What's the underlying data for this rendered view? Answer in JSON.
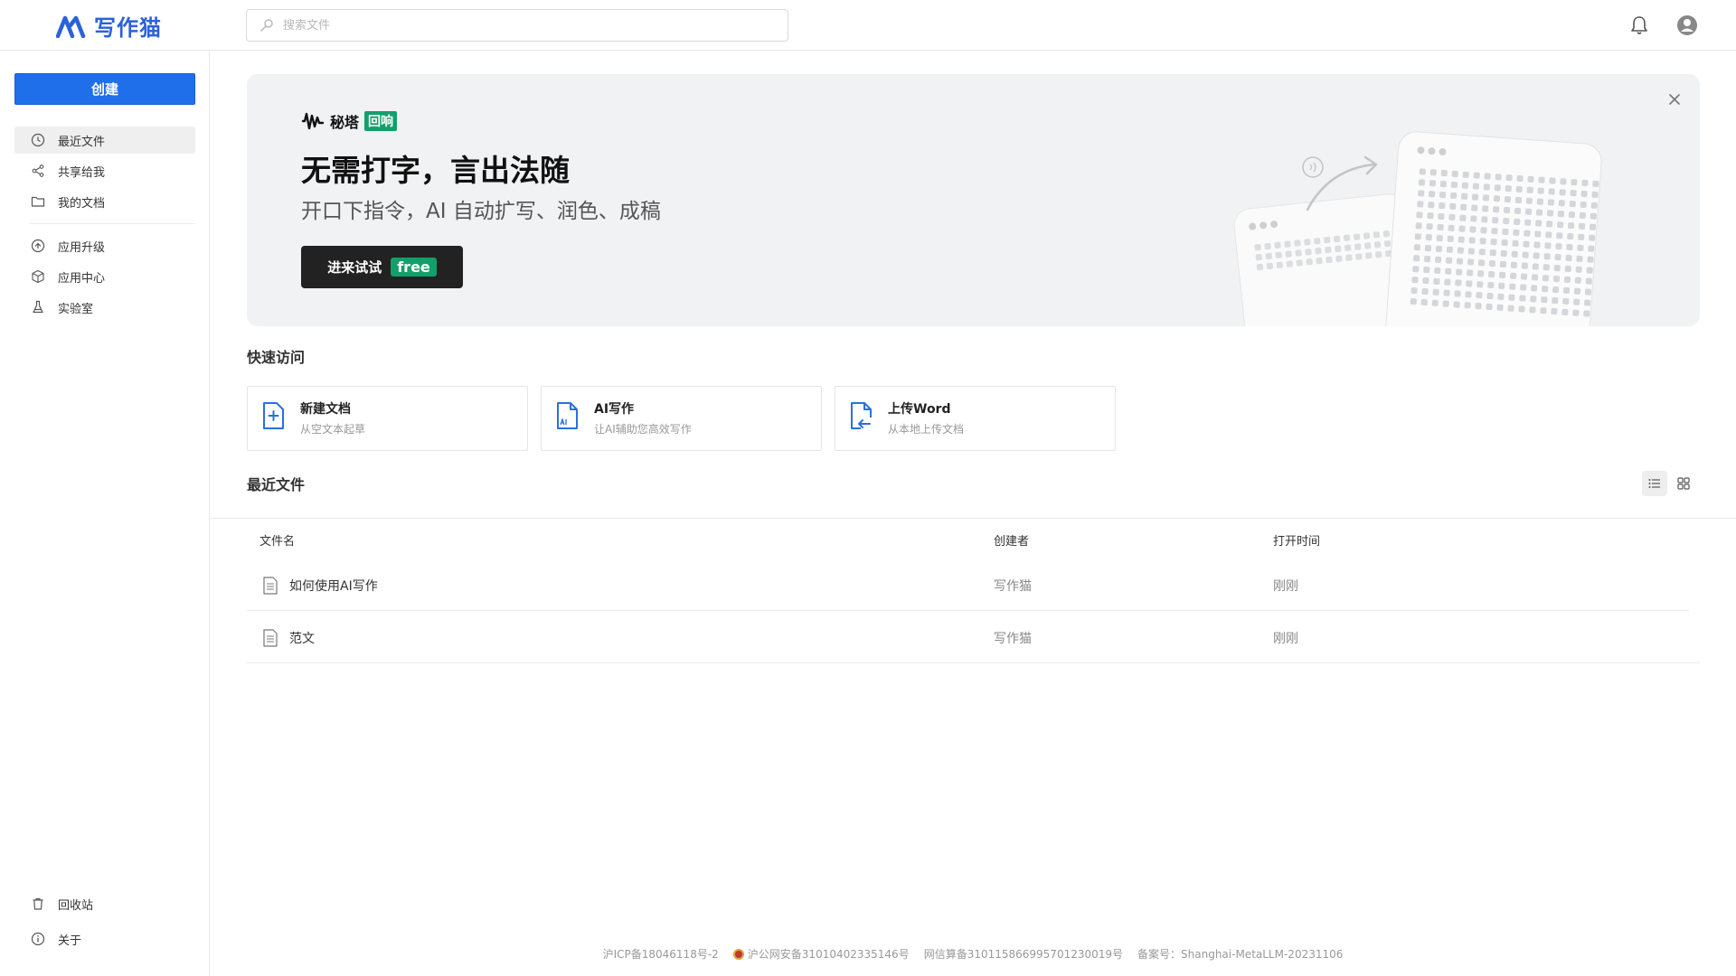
{
  "header": {
    "logo_text": "写作猫",
    "search_placeholder": "搜索文件"
  },
  "sidebar": {
    "create_label": "创建",
    "nav_main": [
      {
        "label": "最近文件",
        "icon": "clock-icon"
      },
      {
        "label": "共享给我",
        "icon": "share-icon"
      },
      {
        "label": "我的文档",
        "icon": "folder-icon"
      }
    ],
    "nav_apps": [
      {
        "label": "应用升级",
        "icon": "upgrade-icon"
      },
      {
        "label": "应用中心",
        "icon": "box-icon"
      },
      {
        "label": "实验室",
        "icon": "flask-icon"
      }
    ],
    "nav_bottom": [
      {
        "label": "回收站",
        "icon": "trash-icon"
      },
      {
        "label": "关于",
        "icon": "info-icon"
      }
    ]
  },
  "banner": {
    "brand_name": "秘塔",
    "brand_tag": "回响",
    "title": "无需打字，言出法随",
    "subtitle": "开口下指令，AI 自动扩写、润色、成稿",
    "cta_label": "进来试试",
    "cta_badge": "free"
  },
  "quick_access": {
    "title": "快速访问",
    "cards": [
      {
        "title": "新建文档",
        "desc": "从空文本起草",
        "icon": "new-doc-icon"
      },
      {
        "title": "AI写作",
        "desc": "让AI辅助您高效写作",
        "icon": "ai-doc-icon"
      },
      {
        "title": "上传Word",
        "desc": "从本地上传文档",
        "icon": "upload-doc-icon"
      }
    ]
  },
  "recent": {
    "title": "最近文件",
    "columns": {
      "name": "文件名",
      "creator": "创建者",
      "time": "打开时间"
    },
    "rows": [
      {
        "name": "如何使用AI写作",
        "creator": "写作猫",
        "time": "刚刚"
      },
      {
        "name": "范文",
        "creator": "写作猫",
        "time": "刚刚"
      }
    ]
  },
  "footer": {
    "icp": "沪ICP备18046118号-2",
    "police": "沪公网安备31010402335146号",
    "algo": "网信算备310115866995701230019号",
    "record": "备案号：Shanghai-MetaLLM-20231106"
  },
  "colors": {
    "primary": "#1f6feb",
    "logo": "#2a62d9",
    "badge_green": "#12a06a",
    "banner_bg": "#f1f2f4"
  }
}
